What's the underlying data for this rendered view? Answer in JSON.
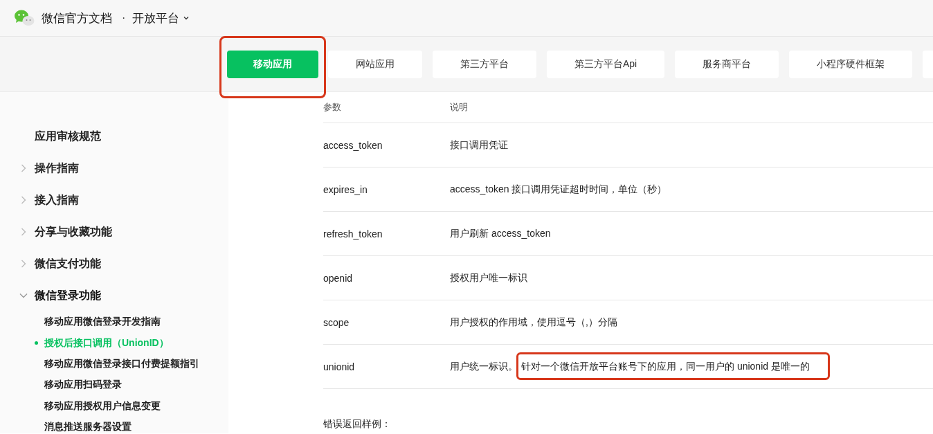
{
  "header": {
    "brand": "微信官方文档",
    "separator": "·",
    "section": "开放平台"
  },
  "tabs": [
    {
      "label": "移动应用",
      "selected": true,
      "highlighted": true
    },
    {
      "label": "网站应用",
      "selected": false,
      "highlighted": false
    },
    {
      "label": "第三方平台",
      "selected": false,
      "highlighted": false
    },
    {
      "label": "第三方平台Api",
      "selected": false,
      "highlighted": false
    },
    {
      "label": "服务商平台",
      "selected": false,
      "highlighted": false
    },
    {
      "label": "小程序硬件框架",
      "selected": false,
      "highlighted": false
    }
  ],
  "sidebar": {
    "items": [
      {
        "label": "应用审核规范",
        "kind": "page"
      },
      {
        "label": "操作指南",
        "kind": "group",
        "expanded": false
      },
      {
        "label": "接入指南",
        "kind": "group",
        "expanded": false
      },
      {
        "label": "分享与收藏功能",
        "kind": "group",
        "expanded": false
      },
      {
        "label": "微信支付功能",
        "kind": "group",
        "expanded": false
      },
      {
        "label": "微信登录功能",
        "kind": "group",
        "expanded": true,
        "children": [
          {
            "label": "移动应用微信登录开发指南",
            "selected": false
          },
          {
            "label": "授权后接口调用（UnionID）",
            "selected": true
          },
          {
            "label": "移动应用微信登录接口付费提额指引",
            "selected": false
          },
          {
            "label": "移动应用扫码登录",
            "selected": false
          },
          {
            "label": "移动应用授权用户信息变更",
            "selected": false
          },
          {
            "label": "消息推送服务器设置",
            "selected": false
          }
        ]
      }
    ]
  },
  "table": {
    "columns": [
      "参数",
      "说明"
    ],
    "rows": [
      {
        "param": "access_token",
        "description": "接口调用凭证"
      },
      {
        "param": "expires_in",
        "description": "access_token 接口调用凭证超时时间，单位（秒）"
      },
      {
        "param": "refresh_token",
        "description": "用户刷新 access_token"
      },
      {
        "param": "openid",
        "description": "授权用户唯一标识"
      },
      {
        "param": "scope",
        "description": "用户授权的作用域，使用逗号（,）分隔"
      },
      {
        "param": "unionid",
        "description": "用户统一标识。",
        "highlight": "针对一个微信开放平台账号下的应用，同一用户的 unionid 是唯一的"
      }
    ]
  },
  "error_example_label": "错误返回样例："
}
